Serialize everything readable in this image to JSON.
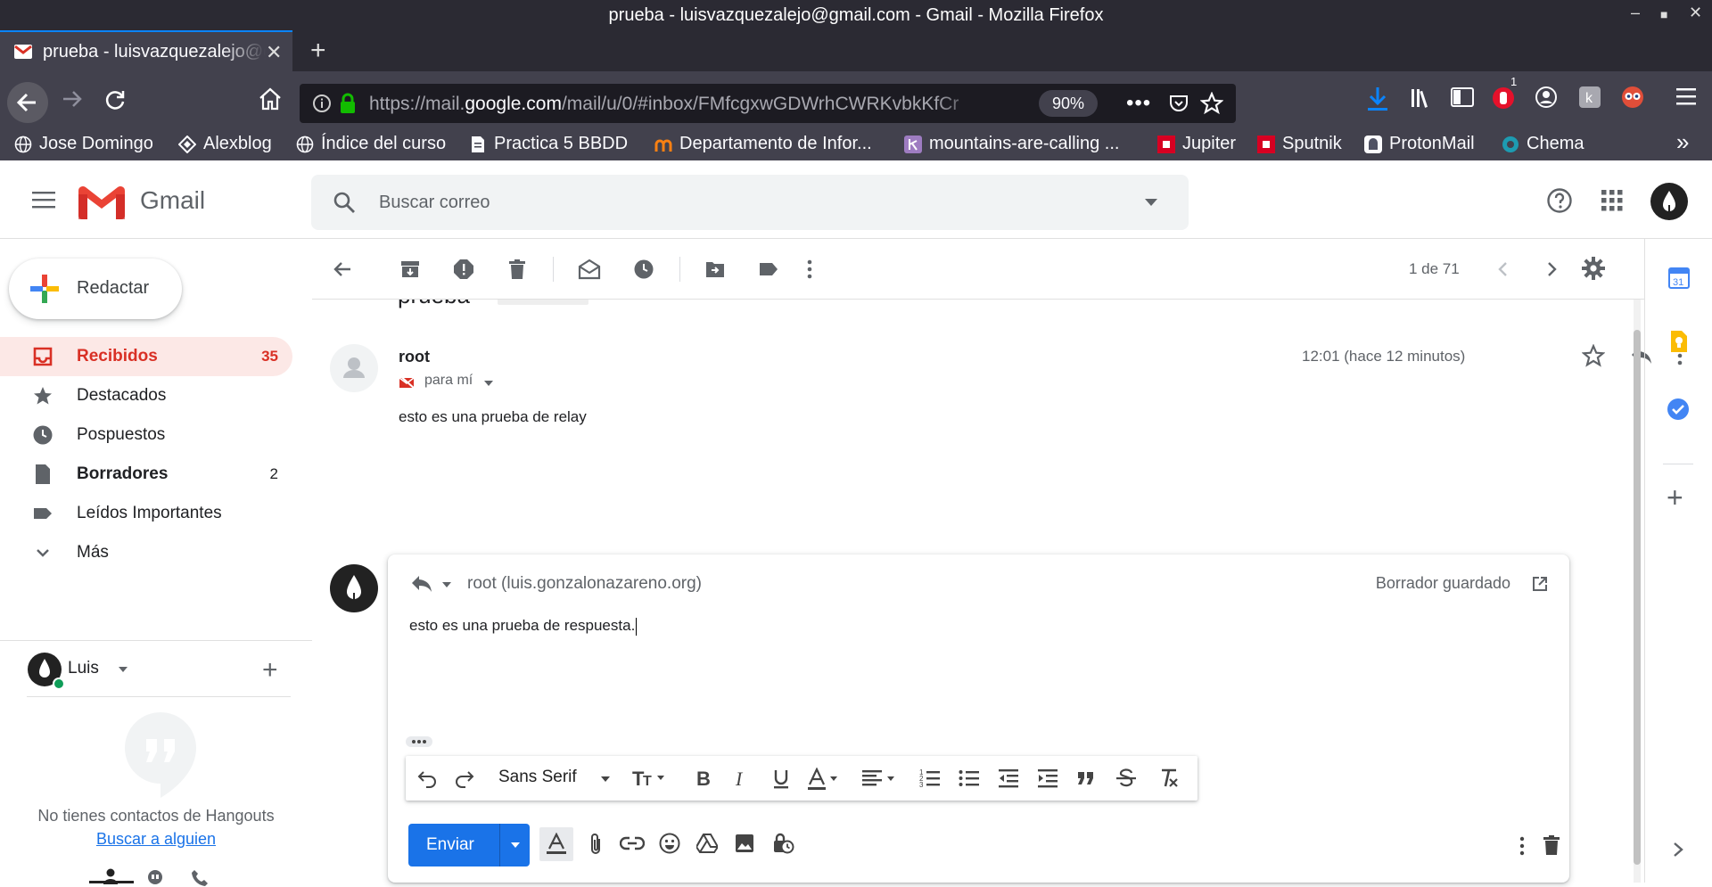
{
  "window": {
    "title": "prueba - luisvazquezalejo@gmail.com - Gmail - Mozilla Firefox"
  },
  "browser": {
    "tab_title": "prueba - luisvazquezalejo@gmail.com",
    "url_prefix": "https://mail.",
    "url_domain": "google.com",
    "url_path": "/mail/u/0/#inbox/FMfcgxwGDWrhCWRKvbkKfCr",
    "zoom": "90%",
    "badge_count": "1",
    "colors": {
      "tab_accent": "#0a84ff",
      "download": "#0a84ff"
    }
  },
  "bookmarks": [
    {
      "label": "Jose Domingo",
      "icon": "globe-icon"
    },
    {
      "label": "Alexblog",
      "icon": "diamond-icon"
    },
    {
      "label": "Índice del curso",
      "icon": "globe-icon"
    },
    {
      "label": "Practica 5 BBDD",
      "icon": "document-icon"
    },
    {
      "label": "Departamento de Infor...",
      "icon": "moodle-icon"
    },
    {
      "label": "mountains-are-calling ...",
      "icon": "heroku-icon"
    },
    {
      "label": "Jupiter",
      "icon": "red-square-icon"
    },
    {
      "label": "Sputnik",
      "icon": "red-square-icon"
    },
    {
      "label": "ProtonMail",
      "icon": "protonmail-icon"
    },
    {
      "label": "Chema",
      "icon": "chema-icon"
    }
  ],
  "gmail": {
    "logo_text": "Gmail",
    "search_placeholder": "Buscar correo",
    "compose_label": "Redactar",
    "nav": [
      {
        "label": "Recibidos",
        "count": "35"
      },
      {
        "label": "Destacados",
        "count": ""
      },
      {
        "label": "Pospuestos",
        "count": ""
      },
      {
        "label": "Borradores",
        "count": "2"
      },
      {
        "label": "Leídos Importantes",
        "count": ""
      },
      {
        "label": "Más",
        "count": ""
      }
    ],
    "hangouts": {
      "user": "Luis",
      "empty_text": "No tienes contactos de Hangouts",
      "find_link": "Buscar a alguien"
    },
    "pager": "1 de 71",
    "message": {
      "subject": "prueba",
      "sender": "root",
      "to": "para mí",
      "time": "12:01 (hace 12 minutos)",
      "body": "esto es una prueba de relay"
    },
    "reply": {
      "recipient": "root (luis.gonzalonazareno.org)",
      "status": "Borrador guardado",
      "text": "esto es una prueba de respuesta.",
      "font": "Sans Serif",
      "send_label": "Enviar"
    },
    "colors": {
      "active_bg": "#fce8e6",
      "active_text": "#d93025",
      "send": "#1a73e8",
      "link": "#1a73e8"
    }
  }
}
